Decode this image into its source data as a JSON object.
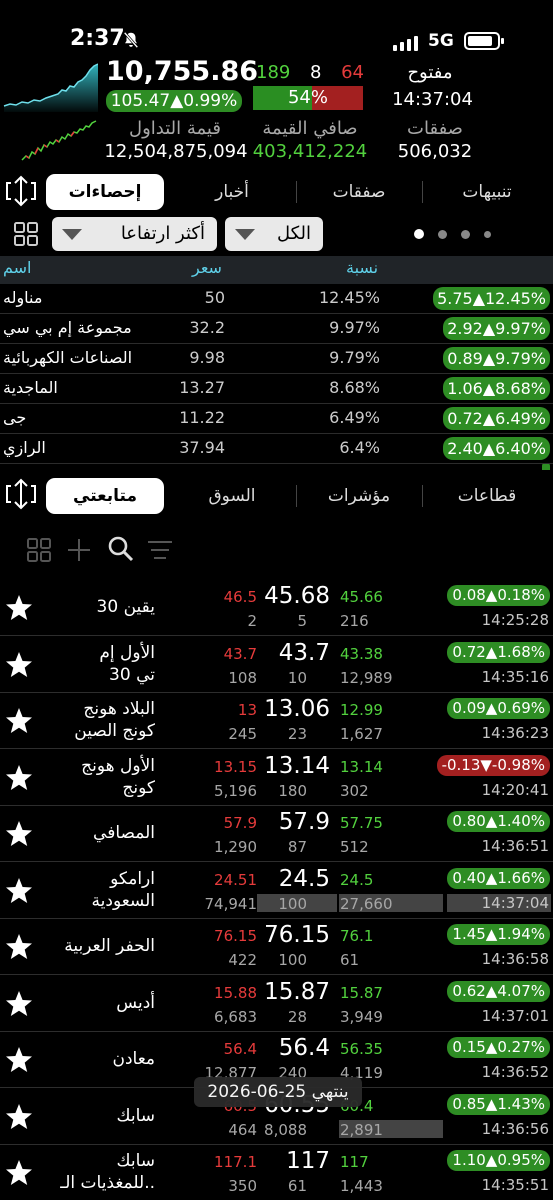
{
  "status_bar": {
    "time": "2:37",
    "network": "5G"
  },
  "summary": {
    "index_value": "10,755.86",
    "change": "105.47▲0.99%",
    "advancers": "189",
    "unchanged": "8",
    "decliners": "64",
    "breadth_pct": "54%",
    "breadth_fraction": 0.54,
    "market_state": "مفتوح",
    "market_time": "14:37:04",
    "turnover_label": "قيمة التداول",
    "turnover_value": "12,504,875,094",
    "net_label": "صافي القيمة",
    "net_value": "403,412,224",
    "trades_label": "صفقات",
    "trades_value": "506,032"
  },
  "tabs_top": {
    "alerts": "تنبيهات",
    "trades": "صفقات",
    "news": "أخبار",
    "stats": "إحصاءات"
  },
  "filters": {
    "scope": "الكل",
    "sort": "أكثر ارتفاعا"
  },
  "movers": {
    "headers": {
      "percent": "نسبة",
      "price": "سعر",
      "name": "اسم"
    },
    "rows": [
      {
        "name": "مناوله",
        "price": "50",
        "percent": "12.45%",
        "pill": "5.75▲12.45%"
      },
      {
        "name": "مجموعة إم بي سي",
        "price": "32.2",
        "percent": "9.97%",
        "pill": "2.92▲9.97%"
      },
      {
        "name": "الصناعات الكهربائية",
        "price": "9.98",
        "percent": "9.79%",
        "pill": "0.89▲9.79%"
      },
      {
        "name": "الماجدية",
        "price": "13.27",
        "percent": "8.68%",
        "pill": "1.06▲8.68%"
      },
      {
        "name": "جى",
        "price": "11.22",
        "percent": "6.49%",
        "pill": "0.72▲6.49%"
      },
      {
        "name": "الرازي",
        "price": "37.94",
        "percent": "6.4%",
        "pill": "2.40▲6.40%"
      }
    ]
  },
  "tabs_bottom": {
    "sectors": "قطاعات",
    "indices": "مؤشرات",
    "market": "السوق",
    "watchlist": "متابعتي"
  },
  "watchlist": [
    {
      "name1": "يقين 30",
      "name2": "",
      "bid": "46.5",
      "bid_qty": "2",
      "last": "45.68",
      "last_qty": "5",
      "ask": "45.66",
      "ask_qty": "216",
      "pill": "0.08▲0.18%",
      "up": true,
      "time": "14:25:28"
    },
    {
      "name1": "الأول إم",
      "name2": "تي 30",
      "bid": "43.7",
      "bid_qty": "108",
      "last": "43.7",
      "last_qty": "10",
      "ask": "43.38",
      "ask_qty": "12,989",
      "pill": "0.72▲1.68%",
      "up": true,
      "time": "14:35:16"
    },
    {
      "name1": "البلاد هونج",
      "name2": "كونج الصين",
      "bid": "13",
      "bid_qty": "245",
      "last": "13.06",
      "last_qty": "23",
      "ask": "12.99",
      "ask_qty": "1,627",
      "pill": "0.09▲0.69%",
      "up": true,
      "time": "14:36:23"
    },
    {
      "name1": "الأول هونج",
      "name2": "كونج",
      "bid": "13.15",
      "bid_qty": "5,196",
      "last": "13.14",
      "last_qty": "180",
      "ask": "13.14",
      "ask_qty": "302",
      "pill": "-0.13▼-0.98%",
      "up": false,
      "time": "14:20:41"
    },
    {
      "name1": "المصافي",
      "name2": "",
      "bid": "57.9",
      "bid_qty": "1,290",
      "last": "57.9",
      "last_qty": "87",
      "ask": "57.75",
      "ask_qty": "512",
      "pill": "0.80▲1.40%",
      "up": true,
      "time": "14:36:51"
    },
    {
      "name1": "ارامكو",
      "name2": "السعودية",
      "bid": "24.51",
      "bid_qty": "74,941",
      "last": "24.5",
      "last_qty": "100",
      "ask": "24.5",
      "ask_qty": "27,660",
      "pill": "0.40▲1.66%",
      "up": true,
      "time": "14:37:04"
    },
    {
      "name1": "الحفر العربية",
      "name2": "",
      "bid": "76.15",
      "bid_qty": "422",
      "last": "76.15",
      "last_qty": "100",
      "ask": "76.1",
      "ask_qty": "61",
      "pill": "1.45▲1.94%",
      "up": true,
      "time": "14:36:58"
    },
    {
      "name1": "أديس",
      "name2": "",
      "bid": "15.88",
      "bid_qty": "6,683",
      "last": "15.87",
      "last_qty": "28",
      "ask": "15.87",
      "ask_qty": "3,949",
      "pill": "0.62▲4.07%",
      "up": true,
      "time": "14:37:01"
    },
    {
      "name1": "معادن",
      "name2": "",
      "bid": "56.4",
      "bid_qty": "12,877",
      "last": "56.4",
      "last_qty": "240",
      "ask": "56.35",
      "ask_qty": "4,119",
      "pill": "0.15▲0.27%",
      "up": true,
      "time": "14:36:52"
    },
    {
      "name1": "سابك",
      "name2": "",
      "bid": "60.5",
      "bid_qty": "464",
      "last": "60.55",
      "last_qty": "8,088",
      "ask": "60.4",
      "ask_qty": "2,891",
      "pill": "0.85▲1.43%",
      "up": true,
      "time": "14:36:56"
    },
    {
      "name1": "سابك",
      "name2": "للمغذيات الـ..",
      "bid": "117.1",
      "bid_qty": "350",
      "last": "117",
      "last_qty": "61",
      "ask": "117",
      "ask_qty": "1,443",
      "pill": "1.10▲0.95%",
      "up": true,
      "time": "14:35:51"
    }
  ],
  "toast": "ينتهي 25-06-2026",
  "colors": {
    "up": "#2e8d24",
    "down": "#a32020",
    "accent": "#5fd0e8"
  }
}
